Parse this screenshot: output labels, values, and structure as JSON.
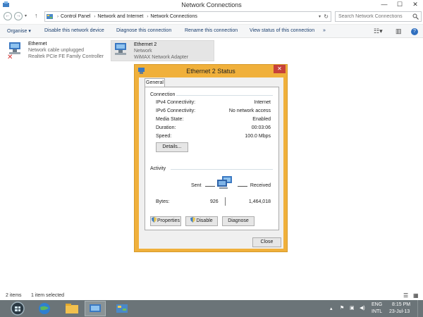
{
  "window": {
    "title": "Network Connections",
    "minimize": "—",
    "maximize": "☐",
    "close": "✕"
  },
  "address": {
    "crumbs": [
      "Control Panel",
      "Network and Internet",
      "Network Connections"
    ],
    "search_placeholder": "Search Network Connections"
  },
  "commands": {
    "organise": "Organise ▾",
    "disable": "Disable this network device",
    "diagnose": "Diagnose this connection",
    "rename": "Rename this connection",
    "view_status": "View status of this connection",
    "more": "»"
  },
  "connections": [
    {
      "name": "Ethernet",
      "status": "Network cable unplugged",
      "adapter": "Realtek PCIe FE Family Controller"
    },
    {
      "name": "Ethernet 2",
      "status": "Network",
      "adapter": "WiMAX Network Adapter"
    }
  ],
  "dialog": {
    "title": "Ethernet 2 Status",
    "close": "✕",
    "tab": "General",
    "connection_header": "Connection",
    "rows": [
      {
        "label": "IPv4 Connectivity:",
        "value": "Internet"
      },
      {
        "label": "IPv6 Connectivity:",
        "value": "No network access"
      },
      {
        "label": "Media State:",
        "value": "Enabled"
      },
      {
        "label": "Duration:",
        "value": "00:03:06"
      },
      {
        "label": "Speed:",
        "value": "100.0 Mbps"
      }
    ],
    "details_btn": "Details...",
    "activity_header": "Activity",
    "sent_label": "Sent",
    "received_label": "Received",
    "bytes_label": "Bytes:",
    "bytes_sent": "926",
    "bytes_received": "1,464,018",
    "properties_btn": "Properties",
    "disable_btn": "Disable",
    "diagnose_btn": "Diagnose",
    "close_btn": "Close"
  },
  "statusbar": {
    "count": "2 items",
    "selected": "1 item selected"
  },
  "tray": {
    "lang": "ENG",
    "layout": "INTL",
    "time": "8:15 PM",
    "date": "23-Jul-13"
  }
}
